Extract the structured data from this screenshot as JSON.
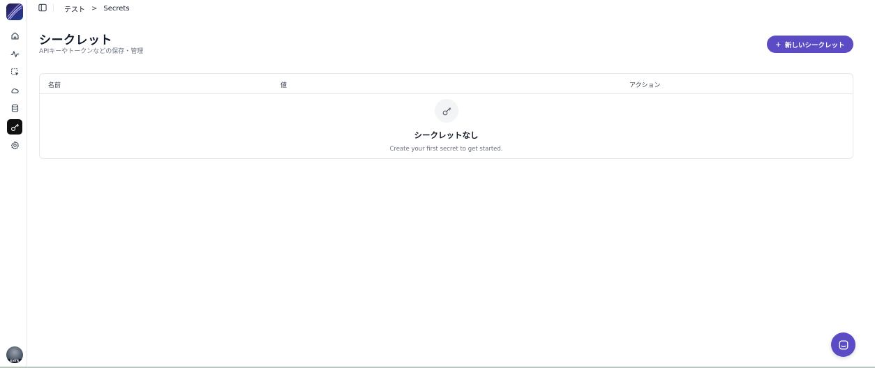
{
  "breadcrumb": {
    "project": "テスト",
    "separator": ">",
    "current": "Secrets"
  },
  "header": {
    "title": "シークレット",
    "subtitle": "APIキーやトークンなどの保存・管理",
    "new_button_label": "新しいシークレット",
    "new_button_plus": "+"
  },
  "table": {
    "columns": [
      "名前",
      "値",
      "アクション"
    ]
  },
  "empty_state": {
    "title": "シークレットなし",
    "subtitle": "Create your first secret to get started."
  },
  "avatar": {
    "tag": "ENTR"
  },
  "sidebar": {
    "items": [
      {
        "icon": "home-icon"
      },
      {
        "icon": "activity-icon"
      },
      {
        "icon": "select-icon"
      },
      {
        "icon": "cloud-icon"
      },
      {
        "icon": "database-icon"
      },
      {
        "icon": "key-icon",
        "active": true
      },
      {
        "icon": "settings-icon"
      }
    ]
  },
  "colors": {
    "accent": "#5b4bc4",
    "active_nav": "#111111"
  }
}
